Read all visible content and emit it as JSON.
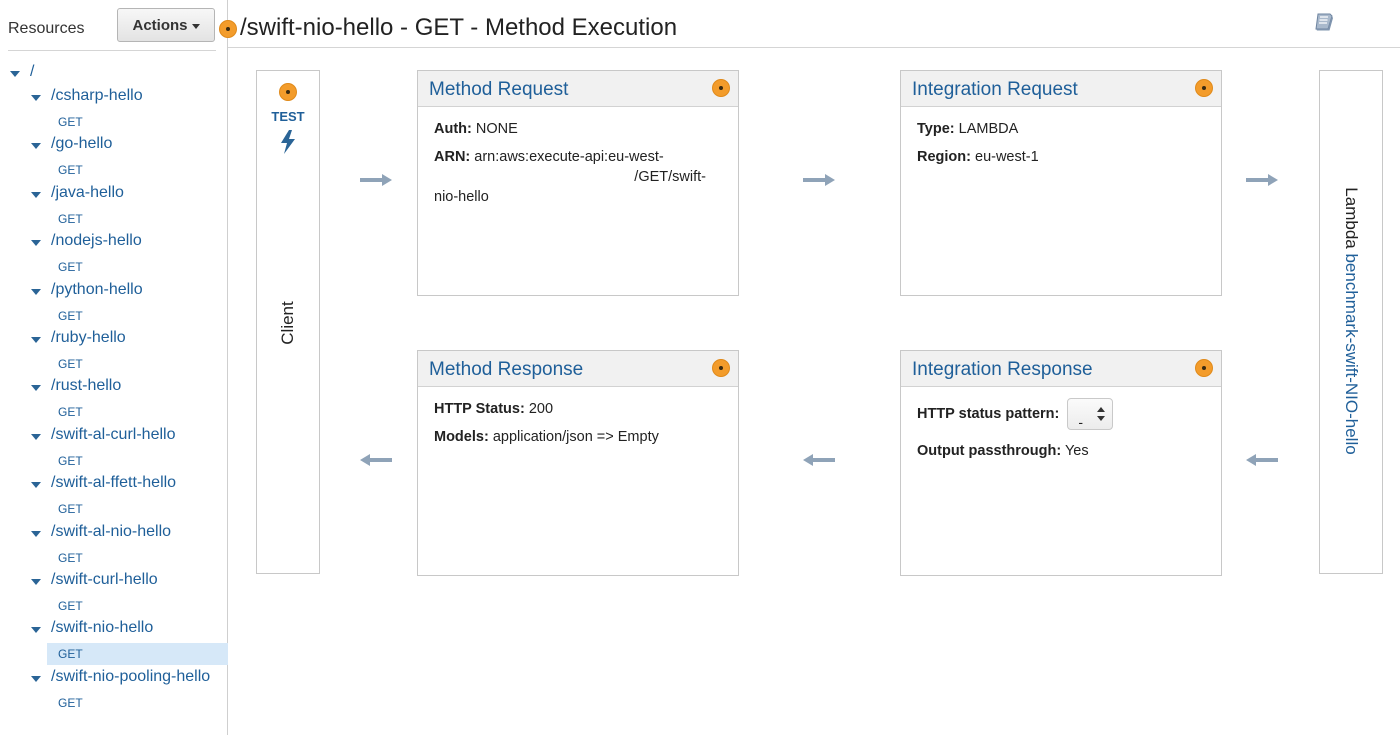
{
  "sidebar": {
    "resources_label": "Resources",
    "actions_label": "Actions",
    "root_label": "/",
    "resources": [
      {
        "path": "/csharp-hello",
        "method": "GET"
      },
      {
        "path": "/go-hello",
        "method": "GET"
      },
      {
        "path": "/java-hello",
        "method": "GET"
      },
      {
        "path": "/nodejs-hello",
        "method": "GET"
      },
      {
        "path": "/python-hello",
        "method": "GET"
      },
      {
        "path": "/ruby-hello",
        "method": "GET"
      },
      {
        "path": "/rust-hello",
        "method": "GET"
      },
      {
        "path": "/swift-al-curl-hello",
        "method": "GET"
      },
      {
        "path": "/swift-al-ffett-hello",
        "method": "GET"
      },
      {
        "path": "/swift-al-nio-hello",
        "method": "GET"
      },
      {
        "path": "/swift-curl-hello",
        "method": "GET"
      },
      {
        "path": "/swift-nio-hello",
        "method": "GET"
      },
      {
        "path": "/swift-nio-pooling-hello",
        "method": "GET"
      }
    ],
    "selected_resource": "/swift-nio-hello"
  },
  "header": {
    "title": "/swift-nio-hello - GET - Method Execution"
  },
  "client": {
    "test_label": "TEST",
    "label": "Client"
  },
  "method_request": {
    "title": "Method Request",
    "auth_label": "Auth:",
    "auth_value": "NONE",
    "arn_label": "ARN:",
    "arn_value_line1": "arn:aws:execute-api:eu-west-",
    "arn_value_line2": "/GET/swift-",
    "arn_value_line3": "nio-hello"
  },
  "integration_request": {
    "title": "Integration Request",
    "type_label": "Type:",
    "type_value": "LAMBDA",
    "region_label": "Region:",
    "region_value": "eu-west-1"
  },
  "method_response": {
    "title": "Method Response",
    "status_label": "HTTP Status:",
    "status_value": "200",
    "models_label": "Models:",
    "models_value": "application/json => Empty"
  },
  "integration_response": {
    "title": "Integration Response",
    "pattern_label": "HTTP status pattern:",
    "pattern_value": "-",
    "passthrough_label": "Output passthrough:",
    "passthrough_value": "Yes"
  },
  "lambda": {
    "prefix": "Lambda",
    "function_name": "benchmark-swift-NIO-hello"
  },
  "colors": {
    "accent_orange": "#f39c2b",
    "link_blue": "#1f5f99",
    "selected_bg": "#d6e8f8",
    "arrow_gray": "#8fa3b8"
  }
}
